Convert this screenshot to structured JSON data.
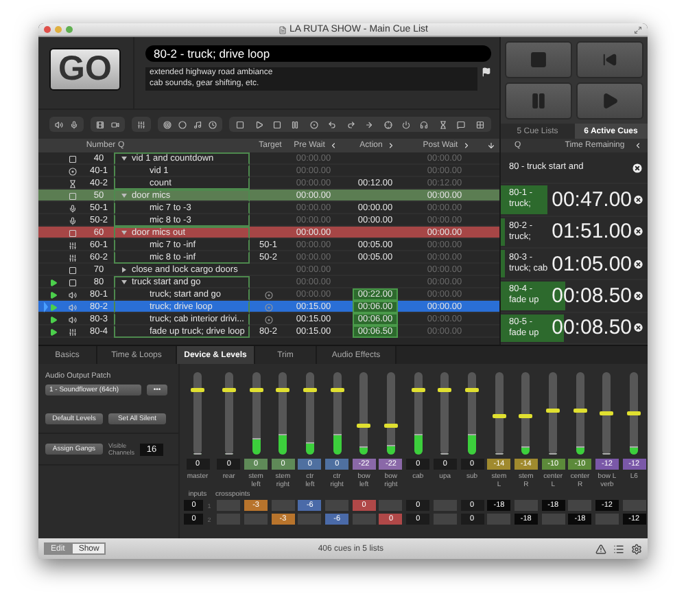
{
  "window": {
    "title": "LA RUTA SHOW - Main Cue List"
  },
  "go_button": {
    "label": "GO"
  },
  "current_cue": {
    "title": "80-2 - truck; drive loop",
    "notes": "extended highway road ambiance\ncab sounds, gear shifting, etc."
  },
  "list_tabs": [
    {
      "label": "5 Cue Lists",
      "selected": false
    },
    {
      "label": "6 Active Cues",
      "selected": true
    }
  ],
  "columns": {
    "number": "Number",
    "q": "Q",
    "target": "Target",
    "pre_wait": "Pre Wait",
    "action": "Action",
    "post_wait": "Post Wait"
  },
  "cues": [
    {
      "kind": "group",
      "number": "40",
      "q": "vid 1 and countdown",
      "expanded": true,
      "playing": false,
      "selected": false,
      "pre_wait": {
        "text": "00:00.00",
        "dim": true
      },
      "post_wait": {
        "text": "00:00.00",
        "dim": true
      },
      "children": [
        {
          "kind": "video",
          "number": "40-1",
          "q": "vid 1",
          "playing": false,
          "selected": false,
          "pre_wait": {
            "text": "00:00.00",
            "dim": true
          },
          "post_wait": {
            "text": "00:00.00",
            "dim": true
          }
        },
        {
          "kind": "wait",
          "number": "40-2",
          "q": "count",
          "playing": false,
          "selected": false,
          "pre_wait": {
            "text": "00:00.00",
            "dim": true
          },
          "action": {
            "text": "00:12.00",
            "dim": false
          },
          "post_wait": {
            "text": "00:12.00",
            "dim": true
          }
        }
      ]
    },
    {
      "kind": "group",
      "number": "50",
      "q": "door mics",
      "expanded": true,
      "playing": false,
      "selected": false,
      "color": "#5b7d52",
      "pre_wait": {
        "text": "00:00.00",
        "dim": false
      },
      "post_wait": {
        "text": "00:00.00",
        "dim": false
      },
      "children": [
        {
          "kind": "mic",
          "number": "50-1",
          "q": "mic 7 to -3",
          "playing": false,
          "selected": false,
          "pre_wait": {
            "text": "00:00.00",
            "dim": true
          },
          "action": {
            "text": "00:00.00",
            "dim": false
          },
          "post_wait": {
            "text": "00:00.00",
            "dim": true
          }
        },
        {
          "kind": "mic",
          "number": "50-2",
          "q": "mic 8 to -3",
          "playing": false,
          "selected": false,
          "pre_wait": {
            "text": "00:00.00",
            "dim": true
          },
          "action": {
            "text": "00:00.00",
            "dim": false
          },
          "post_wait": {
            "text": "00:00.00",
            "dim": true
          }
        }
      ]
    },
    {
      "kind": "group",
      "number": "60",
      "q": "door mics out",
      "expanded": true,
      "playing": false,
      "selected": false,
      "color": "#a64646",
      "pre_wait": {
        "text": "00:00.00",
        "dim": false
      },
      "post_wait": {
        "text": "00:00.00",
        "dim": false
      },
      "children": [
        {
          "kind": "fade",
          "number": "60-1",
          "q": "mic 7 to -inf",
          "target": "50-1",
          "playing": false,
          "selected": false,
          "pre_wait": {
            "text": "00:00.00",
            "dim": true
          },
          "action": {
            "text": "00:05.00",
            "dim": false
          },
          "post_wait": {
            "text": "00:00.00",
            "dim": true
          }
        },
        {
          "kind": "fade",
          "number": "60-2",
          "q": "mic 8 to -inf",
          "target": "50-2",
          "playing": false,
          "selected": false,
          "pre_wait": {
            "text": "00:00.00",
            "dim": true
          },
          "action": {
            "text": "00:05.00",
            "dim": false
          },
          "post_wait": {
            "text": "00:00.00",
            "dim": true
          }
        }
      ]
    },
    {
      "kind": "group",
      "number": "70",
      "q": "close and lock cargo doors",
      "expanded": false,
      "playing": false,
      "selected": false,
      "pre_wait": {
        "text": "00:00.00",
        "dim": true
      },
      "post_wait": {
        "text": "00:00.00",
        "dim": true
      }
    },
    {
      "kind": "group",
      "number": "80",
      "q": "truck start and go",
      "expanded": true,
      "playing": true,
      "selected": false,
      "pre_wait": {
        "text": "00:00.00",
        "dim": true
      },
      "post_wait": {
        "text": "00:00.00",
        "dim": true
      },
      "children": [
        {
          "kind": "audio",
          "number": "80-1",
          "q": "truck; start and go",
          "file_target": true,
          "playing": true,
          "selected": false,
          "pre_wait": {
            "text": "00:00.00",
            "dim": true
          },
          "action": {
            "text": "00:22.00",
            "dim": false
          },
          "post_wait": {
            "text": "00:00.00",
            "dim": true
          }
        },
        {
          "kind": "audio",
          "number": "80-2",
          "q": "truck; drive loop",
          "file_target": true,
          "playing": true,
          "selected": true,
          "pre_wait": {
            "text": "00:15.00",
            "dim": false
          },
          "action": {
            "text": "00:06.00",
            "dim": false
          },
          "post_wait": {
            "text": "00:00.00",
            "dim": false
          }
        },
        {
          "kind": "audio",
          "number": "80-3",
          "q": "truck; cab interior drivi...",
          "file_target": true,
          "playing": true,
          "selected": false,
          "pre_wait": {
            "text": "00:15.00",
            "dim": false
          },
          "action": {
            "text": "00:06.00",
            "dim": false
          },
          "post_wait": {
            "text": "00:00.00",
            "dim": true
          }
        },
        {
          "kind": "fade",
          "number": "80-4",
          "q": "fade up truck; drive loop",
          "target": "80-2",
          "playing": true,
          "selected": false,
          "pre_wait": {
            "text": "00:15.00",
            "dim": false
          },
          "action": {
            "text": "00:06.50",
            "dim": false
          },
          "post_wait": {
            "text": "00:00.00",
            "dim": true
          }
        }
      ]
    }
  ],
  "active_cues": {
    "columns": {
      "q": "Q",
      "time": "Time Remaining"
    },
    "items": [
      {
        "label": "80 - truck start and"
      },
      {
        "label": "80-1 - truck;",
        "time": "00:47.00",
        "level": 0.32
      },
      {
        "label": "80-2 - truck;",
        "time": "01:51.00",
        "level": 0.03
      },
      {
        "label": "80-3 - truck; cab",
        "time": "01:05.00",
        "level": 0.03
      },
      {
        "label": "80-4 - fade up",
        "time": "00:08.50",
        "level": 0.44
      },
      {
        "label": "80-5 - fade up",
        "time": "00:08.50",
        "level": 0.43
      }
    ]
  },
  "inspector_tabs": [
    {
      "label": "Basics",
      "selected": false
    },
    {
      "label": "Time & Loops",
      "selected": false
    },
    {
      "label": "Device & Levels",
      "selected": true
    },
    {
      "label": "Trim",
      "selected": false
    },
    {
      "label": "Audio Effects",
      "selected": false
    }
  ],
  "device": {
    "patch_label": "Audio Output Patch",
    "patch_value": "1 - Soundflower (64ch)",
    "more_button": "•••",
    "default_levels": "Default Levels",
    "set_all_silent": "Set All Silent",
    "assign_gangs": "Assign Gangs",
    "visible_channels_label": "Visible\nChannels",
    "visible_channels": "16"
  },
  "channels": [
    {
      "name": "master",
      "value": "0",
      "color": "#1c1c1c",
      "fader": {
        "level": 0.78
      },
      "meter": {
        "level": 0
      }
    },
    {
      "name": "rear",
      "value": "0",
      "color": "#1c1c1c",
      "fader": {
        "level": 0.78
      },
      "meter": {
        "level": 0
      }
    },
    {
      "name": "stem\nleft",
      "value": "0",
      "color": "#5f8a58",
      "fader": {
        "level": 0.78
      },
      "meter": {
        "level": 0.2
      }
    },
    {
      "name": "stem\nright",
      "value": "0",
      "color": "#5f8a58",
      "fader": {
        "level": 0.78
      },
      "meter": {
        "level": 0.25
      }
    },
    {
      "name": "ctr\nleft",
      "value": "0",
      "color": "#4f70a0",
      "fader": {
        "level": 0.78
      },
      "meter": {
        "level": 0.15
      }
    },
    {
      "name": "ctr\nright",
      "value": "0",
      "color": "#4f70a0",
      "fader": {
        "level": 0.78
      },
      "meter": {
        "level": 0.25
      }
    },
    {
      "name": "bow\nleft",
      "value": "-22",
      "color": "#8a68a8",
      "fader": {
        "level": 0.35
      },
      "meter": {
        "level": 0.1
      }
    },
    {
      "name": "bow\nright",
      "value": "-22",
      "color": "#8a68a8",
      "fader": {
        "level": 0.35
      },
      "meter": {
        "level": 0.12
      }
    },
    {
      "name": "cab",
      "value": "0",
      "color": "#1c1c1c",
      "fader": {
        "level": 0.78
      },
      "meter": {
        "level": 0.25
      }
    },
    {
      "name": "upa",
      "value": "0",
      "color": "#1c1c1c",
      "fader": {
        "level": 0.78
      },
      "meter": {
        "level": 0
      }
    },
    {
      "name": "sub",
      "value": "0",
      "color": "#1c1c1c",
      "fader": {
        "level": 0.78
      },
      "meter": {
        "level": 0.25
      }
    },
    {
      "name": "stem\nL",
      "value": "-14",
      "color": "#a08a2e",
      "fader": {
        "level": 0.46
      },
      "meter": {
        "level": 0
      }
    },
    {
      "name": "stem\nR",
      "value": "-14",
      "color": "#a08a2e",
      "fader": {
        "level": 0.46
      },
      "meter": {
        "level": 0.1
      }
    },
    {
      "name": "center\nL",
      "value": "-10",
      "color": "#5c8a3a",
      "fader": {
        "level": 0.53
      },
      "meter": {
        "level": 0
      }
    },
    {
      "name": "center\nR",
      "value": "-10",
      "color": "#5c8a3a",
      "fader": {
        "level": 0.53
      },
      "meter": {
        "level": 0.1
      }
    },
    {
      "name": "bow L\nverb",
      "value": "-12",
      "color": "#7a58a8",
      "fader": {
        "level": 0.5
      },
      "meter": {
        "level": 0
      }
    },
    {
      "name": "L6",
      "value": "-12",
      "color": "#7a58a8",
      "fader": {
        "level": 0.5
      },
      "meter": {
        "level": 0.1
      }
    }
  ],
  "crosspoints": {
    "inputs_label": "inputs",
    "crosspoints_label": "crosspoints",
    "rows": [
      {
        "index": "1",
        "input": "0",
        "cells": [
          {},
          {
            "value": "-3",
            "color": "#b8742c"
          },
          {},
          {
            "value": "-6",
            "color": "#4a6aa8"
          },
          {},
          {
            "value": "0",
            "color": "#b04848"
          },
          {},
          {
            "value": "0",
            "color": "#1c1c1c"
          },
          {},
          {
            "value": "0",
            "color": "#1c1c1c"
          },
          {
            "value": "-18",
            "color": "#0a0a0a"
          },
          {},
          {
            "value": "-18",
            "color": "#0a0a0a"
          },
          {},
          {
            "value": "-12",
            "color": "#0a0a0a"
          },
          {}
        ]
      },
      {
        "index": "2",
        "input": "0",
        "cells": [
          {},
          {},
          {
            "value": "-3",
            "color": "#b8742c"
          },
          {},
          {
            "value": "-6",
            "color": "#4a6aa8"
          },
          {},
          {
            "value": "0",
            "color": "#b04848"
          },
          {
            "value": "0",
            "color": "#1c1c1c"
          },
          {},
          {
            "value": "0",
            "color": "#1c1c1c"
          },
          {},
          {
            "value": "-18",
            "color": "#0a0a0a"
          },
          {},
          {
            "value": "-18",
            "color": "#0a0a0a"
          },
          {},
          {
            "value": "-12",
            "color": "#0a0a0a"
          }
        ]
      }
    ]
  },
  "mode_buttons": [
    {
      "label": "Edit",
      "selected": true
    },
    {
      "label": "Show",
      "selected": false
    }
  ],
  "status_bar": {
    "text": "406 cues in 5 lists"
  }
}
